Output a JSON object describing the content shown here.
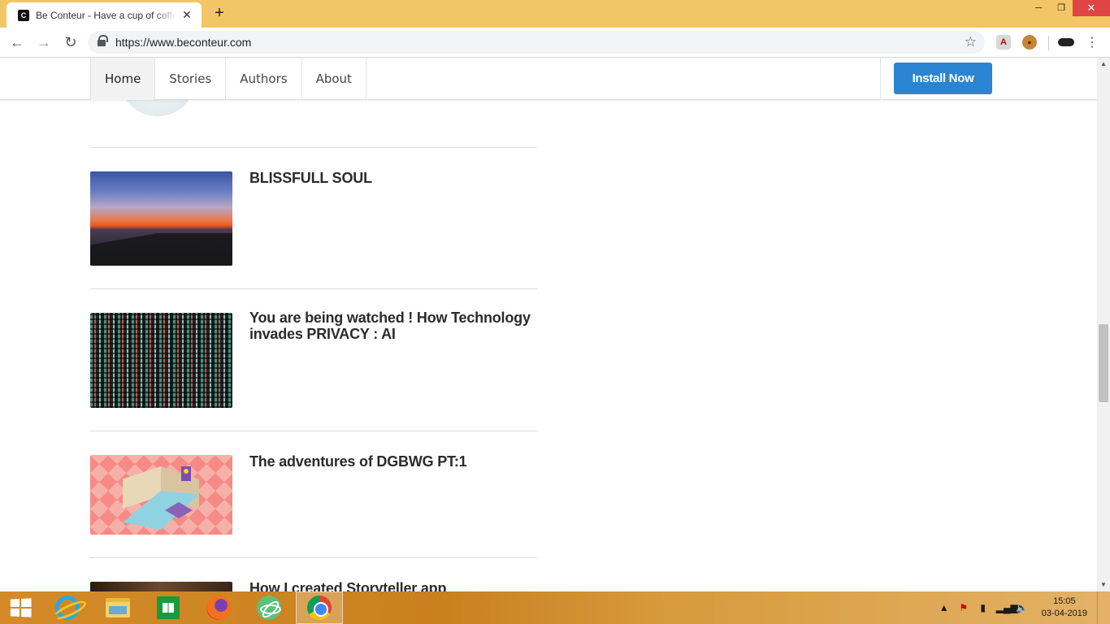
{
  "browser": {
    "tab_title": "Be Conteur - Have a cup of coffee",
    "favicon_letter": "C",
    "tab_close": "✕",
    "new_tab": "+",
    "url": "https://www.beconteur.com",
    "icons": {
      "back": "←",
      "forward": "→",
      "reload": "↻",
      "star": "☆",
      "menu": "⋮",
      "minimize": "─",
      "restore": "❐",
      "close": "✕"
    }
  },
  "site": {
    "nav": [
      "Home",
      "Stories",
      "Authors",
      "About"
    ],
    "install_label": "Install Now",
    "accent_color": "#2a84d2"
  },
  "stories": [
    {
      "title": "BLISSFULL SOUL",
      "image": "sunset-sea"
    },
    {
      "title": "You are being watched ! How Technology invades PRIVACY : AI",
      "image": "code-screen"
    },
    {
      "title": "The adventures of DGBWG PT:1",
      "image": "isometric-room"
    },
    {
      "title": "How I created Storyteller app",
      "image": "dark-photo"
    }
  ],
  "taskbar": {
    "apps": [
      "internet-explorer",
      "file-explorer",
      "store",
      "firefox",
      "atom",
      "chrome"
    ],
    "active_app": "chrome",
    "clock_time": "15:05",
    "clock_date": "03-04-2019"
  }
}
